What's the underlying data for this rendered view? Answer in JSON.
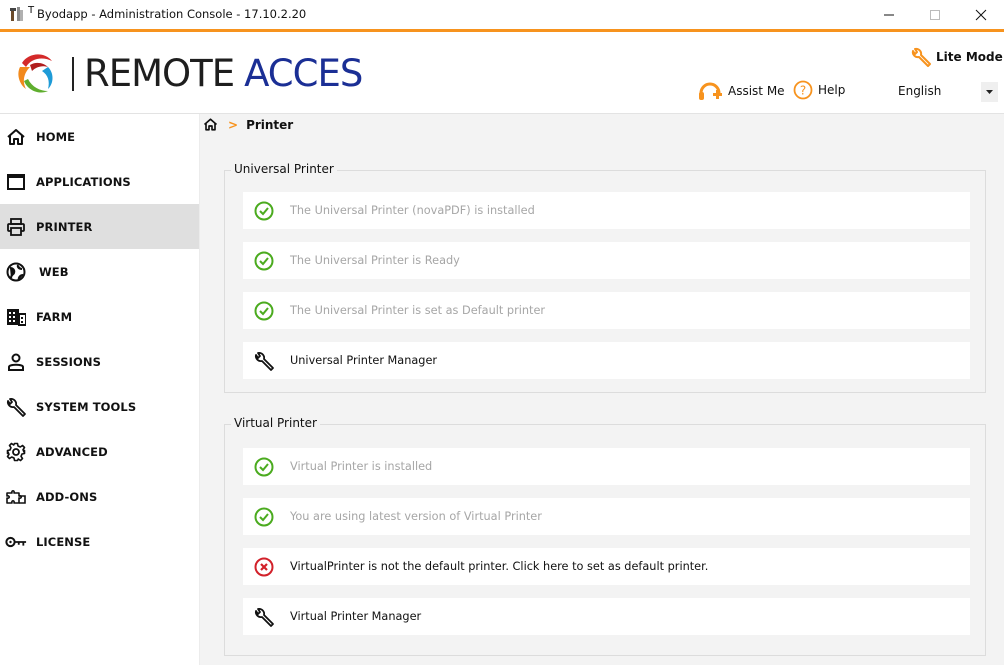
{
  "window": {
    "title_prefix": "T",
    "title": "Byodapp - Administration Console - 17.10.2.20",
    "controls": {
      "minimize": "—",
      "maximize": "☐",
      "close": "✕"
    }
  },
  "header": {
    "logo": {
      "text_part1": "REMOTE",
      "text_part2": "ACCES",
      "icon": "globe-swirl-logo"
    },
    "lite_mode_label": "Lite Mode",
    "assist_label": "Assist Me",
    "help_label": "Help",
    "language": {
      "selected": "English"
    }
  },
  "colors": {
    "accent": "#f7931e",
    "ok": "#4bab1f",
    "error": "#d2212a",
    "logo_blue": "#1b2f95",
    "active_nav": "#dfdfdf",
    "content_bg": "#f3f3f3"
  },
  "sidebar": {
    "items": [
      {
        "label": "HOME",
        "icon": "home-icon",
        "active": false
      },
      {
        "label": "APPLICATIONS",
        "icon": "window-icon",
        "active": false
      },
      {
        "label": "PRINTER",
        "icon": "printer-icon",
        "active": true
      },
      {
        "label": "WEB",
        "icon": "globe-icon",
        "active": false
      },
      {
        "label": "FARM",
        "icon": "building-icon",
        "active": false
      },
      {
        "label": "SESSIONS",
        "icon": "user-icon",
        "active": false
      },
      {
        "label": "SYSTEM TOOLS",
        "icon": "wrench-icon",
        "active": false
      },
      {
        "label": "ADVANCED",
        "icon": "gear-icon",
        "active": false
      },
      {
        "label": "ADD-ONS",
        "icon": "puzzle-icon",
        "active": false
      },
      {
        "label": "LICENSE",
        "icon": "key-icon",
        "active": false
      }
    ]
  },
  "breadcrumb": {
    "separator": ">",
    "current": "Printer"
  },
  "groups": [
    {
      "title": "Universal Printer",
      "rows": [
        {
          "status": "ok",
          "text": "The Universal Printer (novaPDF) is installed"
        },
        {
          "status": "ok",
          "text": "The Universal Printer is Ready"
        },
        {
          "status": "ok",
          "text": "The Universal Printer is set as Default printer"
        },
        {
          "status": "tool",
          "text": "Universal Printer Manager"
        }
      ]
    },
    {
      "title": "Virtual Printer",
      "rows": [
        {
          "status": "ok",
          "text": "Virtual Printer is installed"
        },
        {
          "status": "ok",
          "text": "You are using latest version of Virtual Printer"
        },
        {
          "status": "error",
          "text": "VirtualPrinter is not the default printer. Click here to set as default printer."
        },
        {
          "status": "tool",
          "text": "Virtual Printer Manager"
        }
      ]
    }
  ]
}
